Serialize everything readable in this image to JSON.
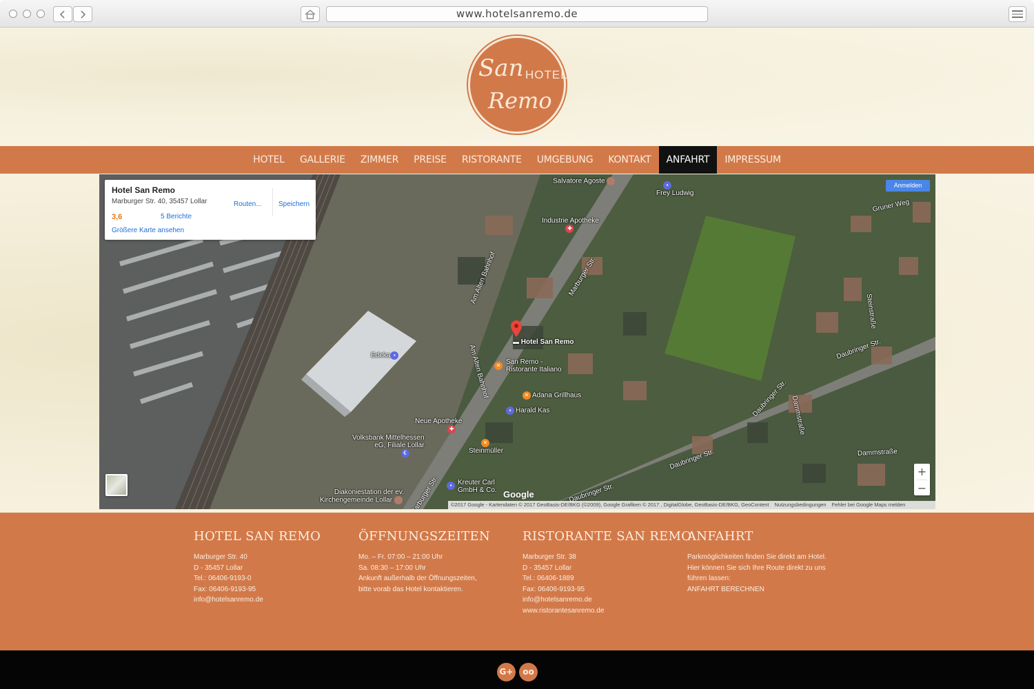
{
  "browser": {
    "url": "www.hotelsanremo.de"
  },
  "logo": {
    "san": "San",
    "hotel": "HOTEL",
    "remo": "Remo"
  },
  "nav": {
    "items": [
      "HOTEL",
      "GALLERIE",
      "ZIMMER",
      "PREISE",
      "RISTORANTE",
      "UMGEBUNG",
      "KONTAKT",
      "ANFAHRT",
      "IMPRESSUM"
    ],
    "active": "ANFAHRT"
  },
  "map": {
    "card": {
      "title": "Hotel San Remo",
      "address": "Marburger Str. 40, 35457 Lollar",
      "route": "Routen...",
      "save": "Speichern",
      "rating": "3,6",
      "reviews": "5 Berichte",
      "larger_map": "Größere Karte ansehen"
    },
    "signin": "Anmelden",
    "zoom_in": "+",
    "zoom_out": "−",
    "google": "Google",
    "pois": {
      "salvatore": "Salvatore Agoste",
      "frey": "Frey Ludwig",
      "apotheke_industrie": "Industrie Apotheke",
      "hotel": "Hotel San Remo",
      "ristorante_1": "San Remo -",
      "ristorante_2": "Ristorante Italiano",
      "adana": "Adana Grillhaus",
      "harald": "Harald Kas",
      "edeka": "Edeka",
      "neue_apotheke": "Neue Apotheke",
      "volksbank_1": "Volksbank Mittelhessen",
      "volksbank_2": "eG, Filiale Lollar",
      "steinmueller": "Steinmüller",
      "kreuter_1": "Kreuter Carl",
      "kreuter_2": "GmbH & Co.",
      "diakonie_1": "Diakoniestation der ev.",
      "diakonie_2": "Kirchengemeinde Lollar"
    },
    "streets": {
      "marburger_1": "Marburger Str.",
      "marburger_2": "Marburger Str.",
      "alten_bahnhof_1": "Am Alten Bahnhof",
      "alten_bahnhof_2": "Am Alten Bahnhof",
      "gruner_weg": "Gruner Weg",
      "steinstrasse": "Steinstraße",
      "daubringer_1": "Daubringer Str.",
      "daubringer_2": "Daubringer Str.",
      "daubringer_3": "Daubringer Str.",
      "daubringer_4": "Daubringer Str.",
      "dammstrasse_1": "Dammstraße",
      "dammstrasse_2": "Dammstraße"
    },
    "attribution": {
      "data": "©2017 Google - Kartendaten © 2017 GeoBasis-DE/BKG (©2009), Google Grafiken © 2017 , DigitalGlobe, GeoBasis-DE/BKG, GeoContent",
      "terms": "Nutzungsbedingungen",
      "report": "Fehler bei Google Maps melden"
    }
  },
  "footer": {
    "hotel": {
      "heading": "HOTEL SAN REMO",
      "lines": [
        "Marburger Str. 40",
        "D - 35457 Lollar",
        "Tel.: 06406-9193-0",
        "Fax: 06406-9193-95",
        "info@hotelsanremo.de"
      ]
    },
    "hours": {
      "heading": "ÖFFNUNGSZEITEN",
      "lines": [
        "Mo. – Fr. 07:00 – 21:00 Uhr",
        "Sa. 08:30 – 17:00 Uhr",
        "Ankunft außerhalb der Öffnungszeiten,",
        "bitte vorab das Hotel kontaktieren."
      ]
    },
    "ristorante": {
      "heading": "RISTORANTE SAN REMO",
      "lines": [
        "Marburger Str. 38",
        "D - 35457 Lollar",
        "Tel.: 06406-1889",
        "Fax: 06406-9193-95",
        "info@hotelsanremo.de",
        "www.ristorantesanremo.de"
      ]
    },
    "anfahrt": {
      "heading": "ANFAHRT",
      "lines": [
        "Parkmöglichkeiten finden Sie direkt am Hotel.",
        "Hier können Sie sich Ihre Route direkt zu uns",
        "führen lassen:",
        "ANFAHRT BERECHNEN"
      ]
    }
  },
  "social": {
    "google_plus": "G+",
    "tripadvisor": "oo"
  },
  "colors": {
    "accent": "#d2794a",
    "nav_active_bg": "#111111",
    "bottom_bar": "#050505"
  }
}
